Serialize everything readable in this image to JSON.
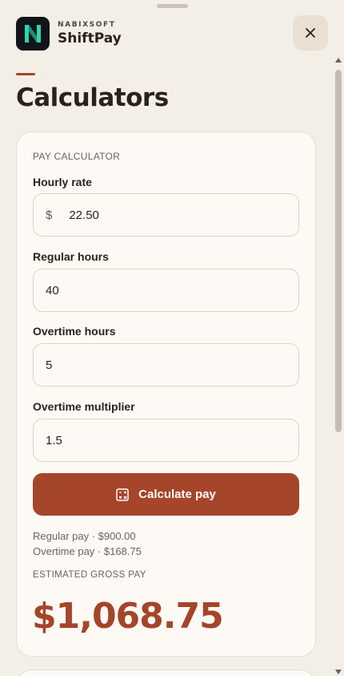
{
  "app": {
    "company": "NABIXSOFT",
    "product": "ShiftPay",
    "logo_letter": "N"
  },
  "page": {
    "title": "Calculators"
  },
  "pay_calculator": {
    "section_label": "PAY CALCULATOR",
    "hourly_rate": {
      "label": "Hourly rate",
      "prefix": "$",
      "value": "22.50"
    },
    "regular_hours": {
      "label": "Regular hours",
      "value": "40"
    },
    "overtime_hours": {
      "label": "Overtime hours",
      "value": "5"
    },
    "overtime_multiplier": {
      "label": "Overtime multiplier",
      "value": "1.5"
    },
    "button_label": "Calculate pay",
    "breakdown": {
      "regular": "Regular pay · $900.00",
      "overtime": "Overtime pay · $168.75"
    },
    "result_label": "ESTIMATED GROSS PAY",
    "result_value": "$1,068.75"
  },
  "colors": {
    "accent": "#a5452a",
    "background": "#f4efe6",
    "card": "#fdfaf5",
    "logo_teal": "#2fd3b0"
  },
  "icons": {
    "close": "close-icon",
    "calculator": "calculator-icon",
    "logo": "logo-icon"
  }
}
